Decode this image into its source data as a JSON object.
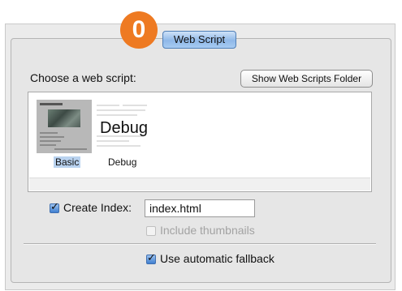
{
  "callout": {
    "number": "0",
    "color": "#ee7a22"
  },
  "tab": {
    "label": "Web Script"
  },
  "choose_label": "Choose a web script:",
  "folder_button": "Show Web Scripts Folder",
  "scripts": [
    {
      "caption": "Basic",
      "selected": true
    },
    {
      "caption": "Debug",
      "thumbnail_text": "Debug",
      "selected": false
    }
  ],
  "create_index": {
    "label": "Create Index:",
    "checked": true,
    "value": "index.html"
  },
  "include_thumbnails": {
    "label": "Include thumbnails",
    "checked": false,
    "enabled": false
  },
  "automatic_fallback": {
    "label": "Use automatic fallback",
    "checked": true
  }
}
